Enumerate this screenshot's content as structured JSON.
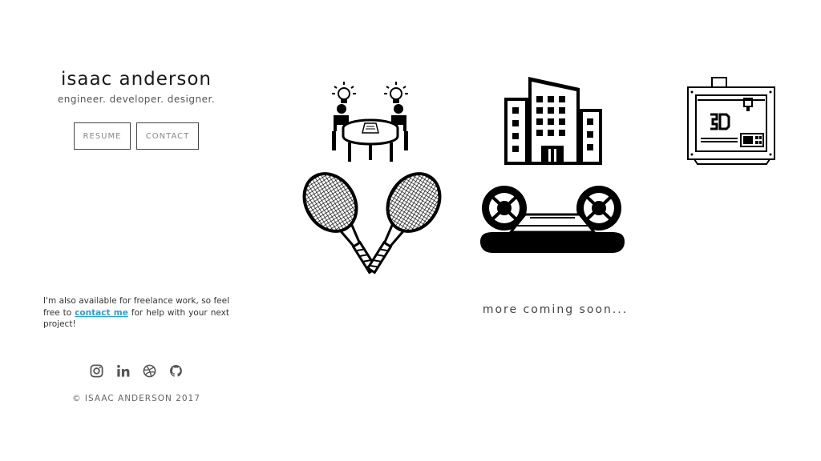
{
  "profile": {
    "name": "isaac anderson",
    "tagline": "engineer. developer. designer."
  },
  "buttons": {
    "resume": "RESUME",
    "contact": "CONTACT"
  },
  "freelance": {
    "before": "I'm also available for freelance work, so feel free to ",
    "link": "contact me",
    "after": " for help with your next project!"
  },
  "social_icons": [
    "instagram-icon",
    "linkedin-icon",
    "dribbble-icon",
    "github-icon"
  ],
  "copyright": "© ISAAC ANDERSON 2017",
  "projects": [
    {
      "icon": "meeting-ideas-icon"
    },
    {
      "icon": "office-building-icon"
    },
    {
      "icon": "3d-printer-icon"
    },
    {
      "icon": "tennis-rackets-icon"
    },
    {
      "icon": "hovercraft-icon"
    }
  ],
  "more_text": "more coming soon..."
}
